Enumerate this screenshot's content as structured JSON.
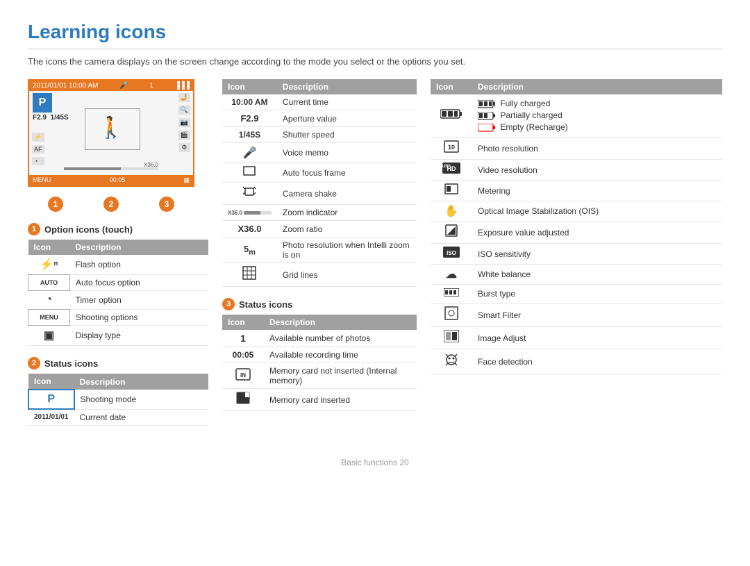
{
  "page": {
    "title": "Learning icons",
    "subtitle": "The icons the camera displays on the screen change according to the mode you select or the options you set.",
    "footer": "Basic functions  20"
  },
  "camera_preview": {
    "datetime": "2011/01/01  10:00 AM",
    "mode": "P",
    "aperture": "F2.9",
    "shutter": "1/45S",
    "remaining": "1",
    "time": "00:05"
  },
  "section1": {
    "badge": "1",
    "title": "Option icons (touch)",
    "col_icon": "Icon",
    "col_desc": "Description",
    "rows": [
      {
        "icon": "⚡ⁿ",
        "description": "Flash option"
      },
      {
        "icon": "AUTO",
        "description": "Auto focus option"
      },
      {
        "icon": "◔",
        "description": "Timer option"
      },
      {
        "icon": "MENU",
        "description": "Shooting options"
      },
      {
        "icon": "▣",
        "description": "Display type"
      }
    ]
  },
  "section2_left": {
    "badge": "2",
    "title": "Status icons",
    "col_icon": "Icon",
    "col_desc": "Description",
    "rows": [
      {
        "icon": "🅟",
        "description": "Shooting mode"
      },
      {
        "icon": "2011/01/01",
        "description": "Current date"
      }
    ]
  },
  "section2_mid": {
    "col_icon": "Icon",
    "col_desc": "Description",
    "rows": [
      {
        "icon": "10:00 AM",
        "description": "Current time"
      },
      {
        "icon": "F2.9",
        "description": "Aperture value"
      },
      {
        "icon": "1/45S",
        "description": "Shutter speed"
      },
      {
        "icon": "🎤",
        "description": "Voice memo"
      },
      {
        "icon": "☐",
        "description": "Auto focus frame"
      },
      {
        "icon": "📷",
        "description": "Camera shake"
      },
      {
        "icon": "━━━",
        "description": "Zoom indicator"
      },
      {
        "icon": "X36.0",
        "description": "Zoom ratio"
      },
      {
        "icon": "5ₘ",
        "description": "Photo resolution when Intelli zoom is on"
      },
      {
        "icon": "⊞",
        "description": "Grid lines"
      }
    ]
  },
  "section3": {
    "badge": "3",
    "title": "Status icons",
    "col_icon": "Icon",
    "col_desc": "Description",
    "rows": [
      {
        "icon": "1",
        "description": "Available number of photos"
      },
      {
        "icon": "00:05",
        "description": "Available recording time"
      },
      {
        "icon": "🗂",
        "description": "Memory card not inserted (Internal memory)"
      },
      {
        "icon": "◀",
        "description": "Memory card inserted"
      }
    ]
  },
  "section_right": {
    "col_icon": "Icon",
    "col_desc": "Description",
    "battery": {
      "full": "Fully charged",
      "partial": "Partially charged",
      "empty": "Empty (Recharge)"
    },
    "rows": [
      {
        "icon": "🖼",
        "description": "Photo resolution"
      },
      {
        "icon": "HD",
        "description": "Video resolution"
      },
      {
        "icon": "⬛",
        "description": "Metering"
      },
      {
        "icon": "✋",
        "description": "Optical Image Stabilization (OIS)"
      },
      {
        "icon": "⊿",
        "description": "Exposure value adjusted"
      },
      {
        "icon": "ISO",
        "description": "ISO sensitivity"
      },
      {
        "icon": "☁",
        "description": "White balance"
      },
      {
        "icon": "▬",
        "description": "Burst type"
      },
      {
        "icon": "⬚",
        "description": "Smart Filter"
      },
      {
        "icon": "▦",
        "description": "Image Adjust"
      },
      {
        "icon": "☺",
        "description": "Face detection"
      }
    ]
  }
}
